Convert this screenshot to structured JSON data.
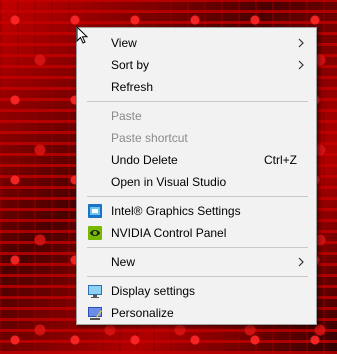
{
  "menu": {
    "view": "View",
    "sort_by": "Sort by",
    "refresh": "Refresh",
    "paste": "Paste",
    "paste_shortcut": "Paste shortcut",
    "undo_delete": "Undo Delete",
    "undo_delete_shortcut": "Ctrl+Z",
    "open_vs": "Open in Visual Studio",
    "intel_graphics": "Intel® Graphics Settings",
    "nvidia_panel": "NVIDIA Control Panel",
    "new": "New",
    "display_settings": "Display settings",
    "personalize": "Personalize"
  },
  "icons": {
    "submenu_arrow": "chevron-right-icon",
    "intel": "intel-graphics-icon",
    "nvidia": "nvidia-icon",
    "display": "display-icon",
    "personalize": "personalize-icon"
  },
  "colors": {
    "menu_bg": "#f2f2f2",
    "disabled_text": "#8a8a8a",
    "nvidia_green": "#76b900",
    "intel_blue": "#1a73c7"
  }
}
